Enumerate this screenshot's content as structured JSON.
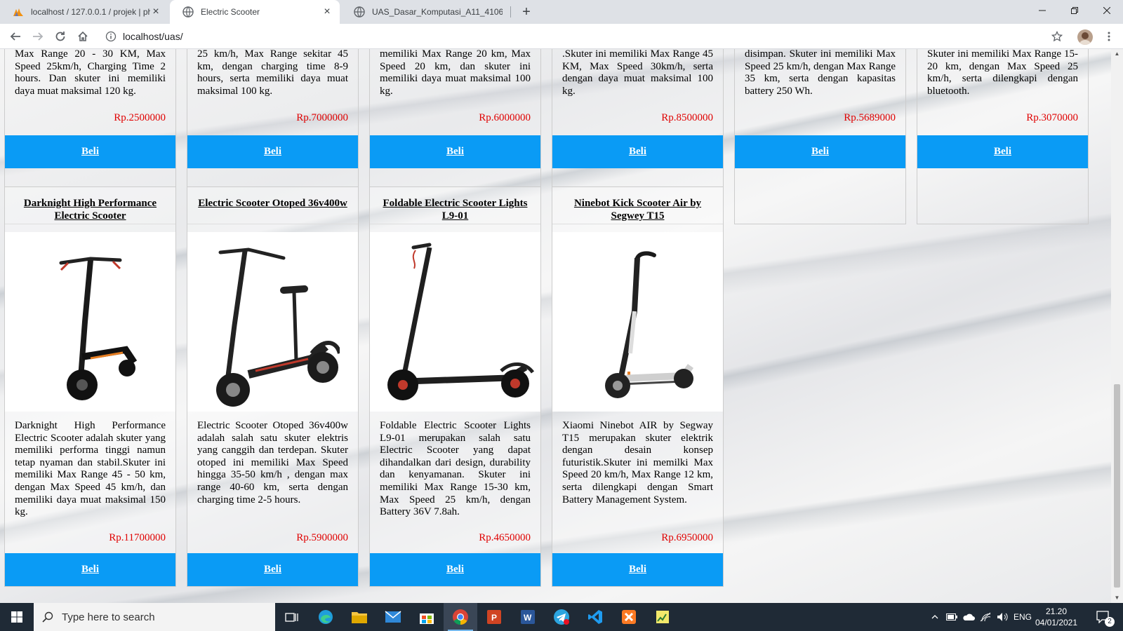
{
  "browser": {
    "tabs": [
      {
        "title": "localhost / 127.0.0.1 / projek | ph",
        "icon": "phpmyadmin-icon",
        "active": false
      },
      {
        "title": "Electric Scooter",
        "icon": "globe-icon",
        "active": true
      },
      {
        "title": "UAS_Dasar_Komputasi_A11_4106",
        "icon": "globe-icon",
        "active": false
      }
    ],
    "new_tab_label": "+",
    "url": "localhost/uas/"
  },
  "top_row": [
    {
      "desc": "Max Range 20 - 30 KM, Max Speed 25km/h, Charging Time 2 hours. Dan skuter ini memiliki daya muat maksimal 120 kg.",
      "price": "Rp.2500000",
      "buy": "Beli"
    },
    {
      "desc": "25 km/h, Max Range sekitar 45 km, dengan charging time 8-9 hours, serta memiliki daya muat maksimal 100 kg.",
      "price": "Rp.7000000",
      "buy": "Beli"
    },
    {
      "desc": "memiliki Max Range 20 km, Max Speed 20 km, dan skuter ini memiliki daya muat maksimal 100 kg.",
      "price": "Rp.6000000",
      "buy": "Beli"
    },
    {
      "desc": ".Skuter ini memiliki Max Range 45 KM, Max Speed 30km/h, serta dengan daya muat maksimal 100 kg.",
      "price": "Rp.8500000",
      "buy": "Beli"
    },
    {
      "desc": "disimpan. Skuter ini memiliki Max Speed 25 km/h, dengan Max Range 35 km, serta dengan kapasitas battery 250 Wh.",
      "price": "Rp.5689000",
      "buy": "Beli"
    },
    {
      "desc": "Skuter ini memiliki Max Range 15-20 km, dengan Max Speed 25 km/h, serta dilengkapi dengan bluetooth.",
      "price": "Rp.3070000",
      "buy": "Beli"
    }
  ],
  "products": [
    {
      "name": "Darknight High Performance Electric Scooter",
      "desc": "Darknight High Performance Electric Scooter adalah skuter yang memiliki performa tinggi namun tetap nyaman dan stabil.Skuter ini memiliki Max Range 45 - 50 km, dengan Max Speed 45 km/h, dan memiliki daya muat maksimal 150 kg.",
      "price": "Rp.11700000",
      "buy": "Beli"
    },
    {
      "name": "Electric Scooter Otoped 36v400w",
      "desc": "Electric Scooter Otoped 36v400w adalah salah satu skuter elektris yang canggih dan terdepan. Skuter otoped ini memiliki Max Speed hingga 35-50 km/h , dengan max range 40-60 km, serta dengan charging time 2-5 hours.",
      "price": "Rp.5900000",
      "buy": "Beli"
    },
    {
      "name": "Foldable Electric Scooter Lights L9-01",
      "desc": "Foldable Electric Scooter Lights L9-01 merupakan salah satu Electric Scooter yang dapat dihandalkan dari design, durability dan kenyamanan. Skuter ini memiliki Max Range 15-30 km, Max Speed 25 km/h, dengan Battery 36V 7.8ah.",
      "price": "Rp.4650000",
      "buy": "Beli"
    },
    {
      "name": "Ninebot Kick Scooter Air by Segwey T15",
      "desc": "Xiaomi Ninebot AIR by Segway T15 merupakan skuter elektrik dengan desain konsep futuristik.Skuter ini memilki Max Speed 20 km/h, Max Range 12 km, serta dilengkapi dengan Smart Battery Management System.",
      "price": "Rp.6950000",
      "buy": "Beli"
    }
  ],
  "taskbar": {
    "search_placeholder": "Type here to search",
    "language": "ENG",
    "time": "21.20",
    "date": "04/01/2021",
    "notification_count": "2"
  },
  "colors": {
    "buy_button": "#0a9bf5",
    "price": "#e00000",
    "taskbar": "#1f2a36"
  }
}
